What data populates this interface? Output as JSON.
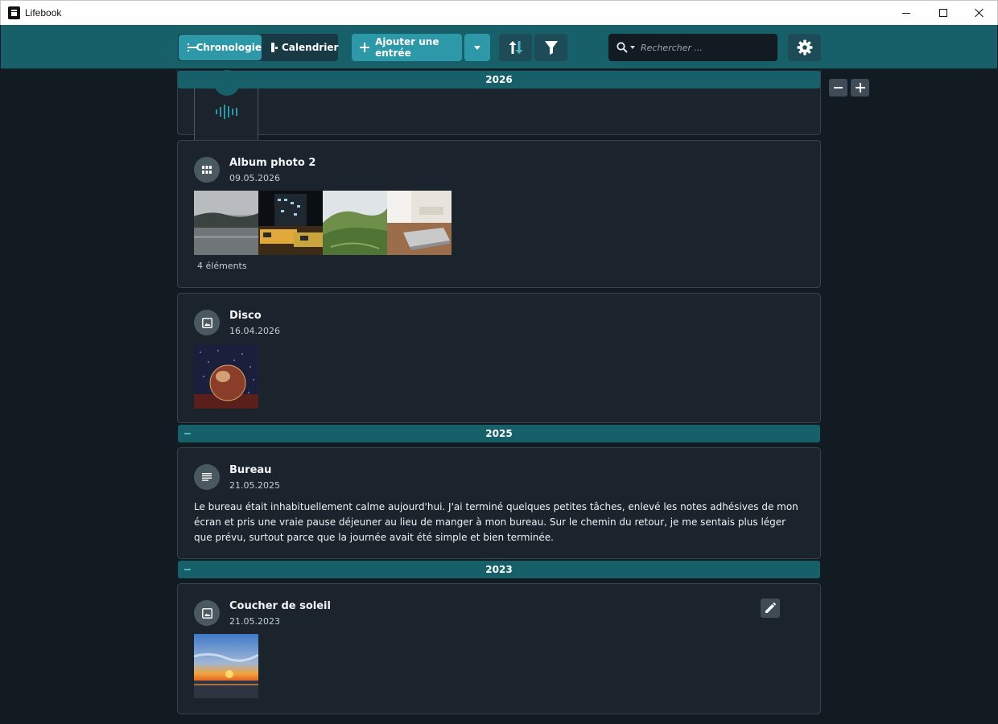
{
  "window": {
    "title": "Lifebook",
    "controls": [
      "minimize",
      "maximize",
      "close"
    ]
  },
  "toolbar": {
    "chrono_label": "Chronologie",
    "calendar_label": "Calendrier",
    "add_label": "Ajouter une entrée",
    "search_placeholder": "Rechercher ...",
    "icons": [
      "menu-icon",
      "calendar-icon",
      "plus-icon",
      "chevron-down-icon",
      "sort-icon",
      "filter-icon",
      "search-icon",
      "gear-icon"
    ]
  },
  "colors": {
    "toolbar_bg": "#17606a",
    "accent": "#2d98a8",
    "content_bg": "#131b22",
    "card_bg": "#1b242d"
  },
  "zoom": {
    "icons": [
      "minus-icon",
      "plus-icon"
    ]
  },
  "years": [
    {
      "label": "2026"
    },
    {
      "label": "2025"
    },
    {
      "label": "2023"
    }
  ],
  "entries": {
    "audio": {
      "icon": "audio-wave-icon"
    },
    "album": {
      "title": "Album photo 2",
      "date": "09.05.2026",
      "count": "4 éléments",
      "icon": "grid-icon"
    },
    "disco": {
      "title": "Disco",
      "date": "16.04.2026",
      "icon": "image-icon"
    },
    "bureau": {
      "title": "Bureau",
      "date": "21.05.2025",
      "icon": "text-lines-icon",
      "text": "Le bureau était inhabituellement calme aujourd'hui. J'ai terminé quelques petites tâches, enlevé les notes adhésives de mon écran et pris une vraie pause déjeuner au lieu de manger à mon bureau. Sur le chemin du retour, je me sentais plus léger que prévu, surtout parce que la journée avait été simple et bien terminée."
    },
    "sunset": {
      "title": "Coucher de soleil",
      "date": "21.05.2023",
      "icon": "image-icon",
      "edit_icon": "pencil-icon"
    }
  }
}
